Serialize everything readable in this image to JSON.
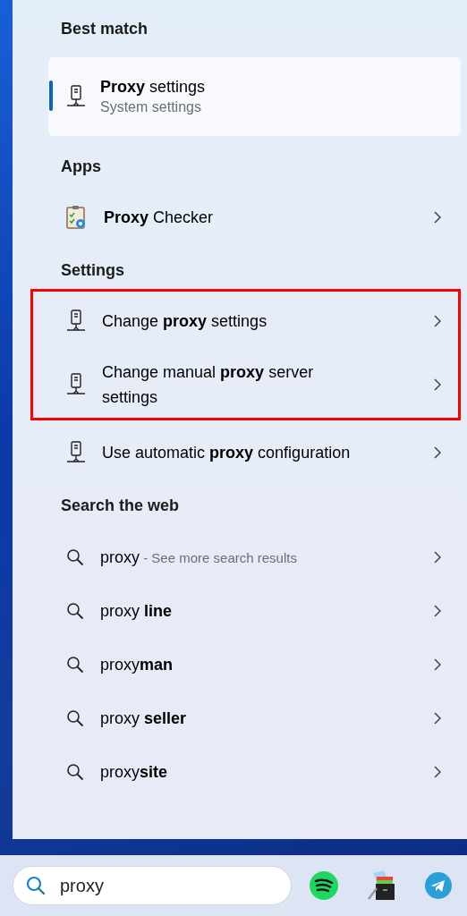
{
  "best_match": {
    "heading": "Best match",
    "item": {
      "title": "**Proxy** settings",
      "subtitle": "System settings",
      "selected": true
    }
  },
  "apps": {
    "heading": "Apps",
    "items": [
      {
        "title": "**Proxy** Checker",
        "selected": false
      }
    ]
  },
  "settings": {
    "heading": "Settings",
    "items": [
      {
        "title": "Change **proxy** settings",
        "highlighted": true,
        "selected": false
      },
      {
        "title": "Change manual **proxy** server settings",
        "highlighted": true,
        "selected": false
      },
      {
        "title": "Use automatic **proxy** configuration",
        "highlighted": false,
        "selected": false
      }
    ]
  },
  "web": {
    "heading": "Search the web",
    "items": [
      {
        "title": "proxy",
        "hint": "- See more search results",
        "selected": false
      },
      {
        "title": "proxy **line**",
        "selected": false
      },
      {
        "title": "proxy**man**",
        "selected": false
      },
      {
        "title": "proxy **seller**",
        "selected": false
      },
      {
        "title": "proxy**site**",
        "selected": false
      }
    ]
  },
  "taskbar": {
    "search": {
      "value": "proxy"
    },
    "apps": [
      {
        "kind": "music"
      },
      {
        "kind": "files"
      },
      {
        "kind": "messenger"
      }
    ]
  }
}
